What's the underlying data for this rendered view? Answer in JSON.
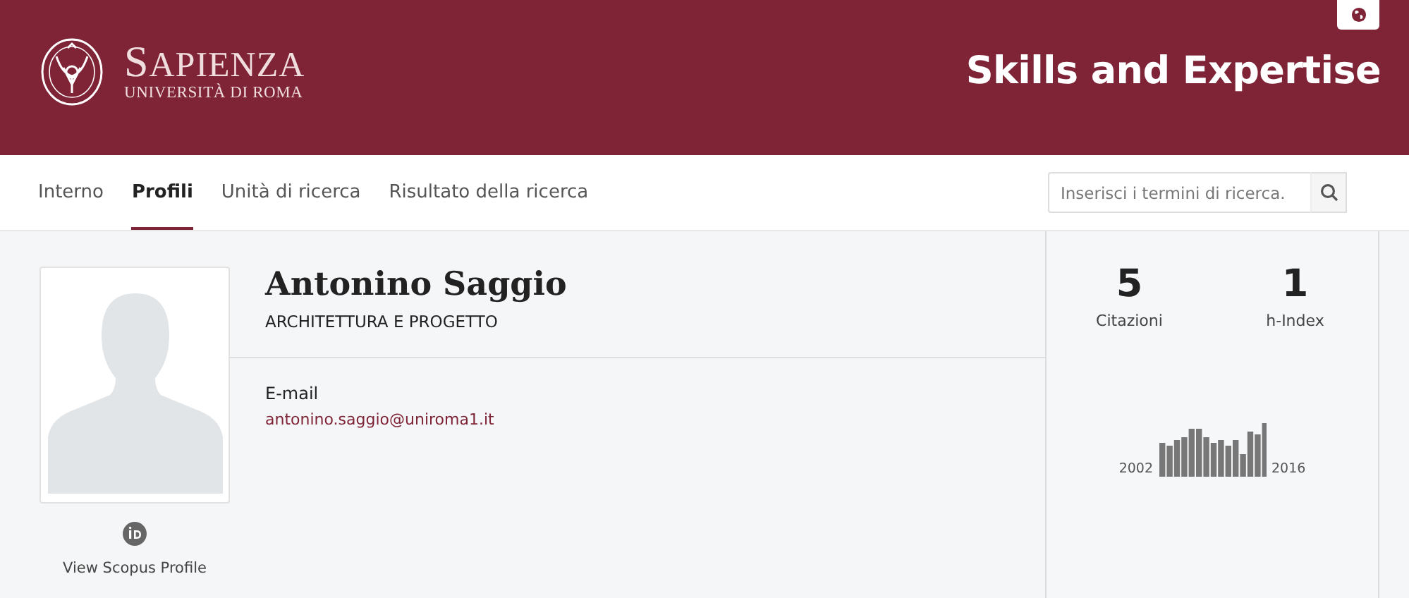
{
  "header": {
    "logo_title": "SAPIENZA",
    "logo_subtitle": "UNIVERSITÀ DI ROMA",
    "site_title": "Skills and Expertise"
  },
  "nav": {
    "tabs": [
      {
        "label": "Interno",
        "selected": false
      },
      {
        "label": "Profili",
        "selected": true
      },
      {
        "label": "Unità di ricerca",
        "selected": false
      },
      {
        "label": "Risultato della ricerca",
        "selected": false
      }
    ],
    "search": {
      "placeholder": "Inserisci i termini di ricerca."
    }
  },
  "profile": {
    "name": "Antonino Saggio",
    "department": "ARCHITETTURA E PROGETTO",
    "email_label": "E-mail",
    "email": "antonino.saggio@uniroma1.it",
    "scopus_link": "View Scopus Profile"
  },
  "metrics": [
    {
      "value": "5",
      "label": "Citazioni"
    },
    {
      "value": "1",
      "label": "h-Index"
    }
  ],
  "sparkline": {
    "start_year": "2002",
    "end_year": "2016"
  }
}
